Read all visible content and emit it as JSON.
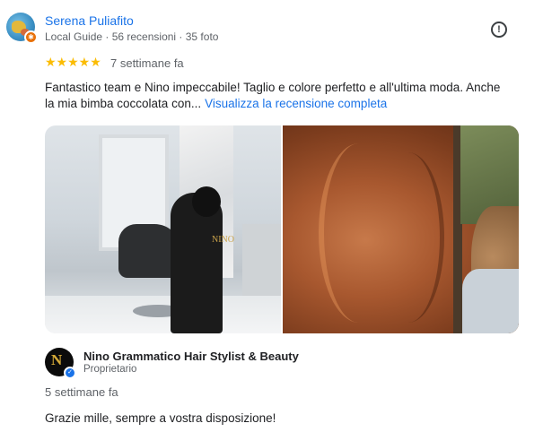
{
  "review": {
    "author_name": "Serena Puliafito",
    "author_meta": "Local Guide · 56 recensioni · 35 foto",
    "stars": "★★★★★",
    "rating": 5,
    "date": "7 settimane fa",
    "text": "Fantastico team e Nino impeccabile! Taglio e colore perfetto e all'ultima moda. Anche la mia bimba coccolata con...",
    "more_link": "Visualizza la recensione completa",
    "report_icon": "!"
  },
  "photos": {
    "photo1_logo_text": "NINO"
  },
  "owner_reply": {
    "logo_mark": "N",
    "name": "Nino Grammatico Hair Stylist & Beauty",
    "role": "Proprietario",
    "date": "5 settimane fa",
    "text": "Grazie mille, sempre a vostra disposizione!"
  },
  "colors": {
    "link": "#1a73e8",
    "star": "#fbbc04",
    "secondary_text": "#5f6368",
    "local_guide_badge": "#e8710a"
  },
  "icons": {
    "avatar_badge": "local-guide-badge-icon",
    "report": "report-flag-icon",
    "verified": "verified-check-icon"
  }
}
